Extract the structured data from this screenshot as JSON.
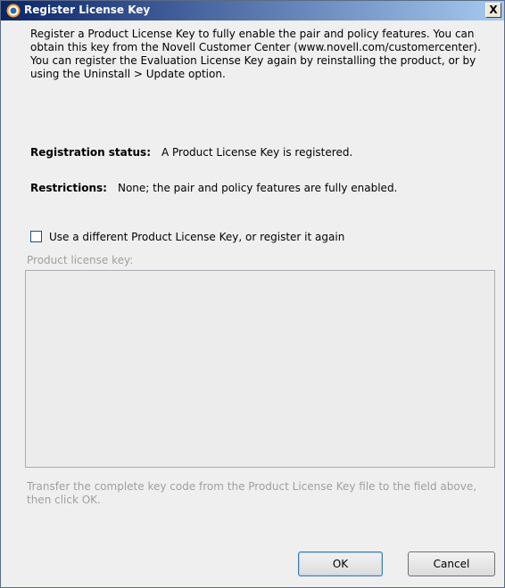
{
  "window": {
    "title": "Register License Key",
    "close_label": "X",
    "title_gradient": [
      "#0a246a",
      "#a6caf0"
    ]
  },
  "intro": {
    "text": "Register a Product License Key to fully enable the pair and policy features. You can obtain this key from the Novell Customer Center (www.novell.com/customercenter). You can register the Evaluation License Key again by reinstalling the product, or by using the Uninstall > Update option."
  },
  "registration": {
    "label": "Registration status:",
    "value": "A Product License Key is registered."
  },
  "restrictions": {
    "label": "Restrictions:",
    "value": "None; the pair and policy features are fully enabled."
  },
  "different_key": {
    "label": "Use a different Product License Key, or register it again",
    "checked": false
  },
  "license_field": {
    "label": "Product license key:",
    "value": "",
    "enabled": false
  },
  "hint": {
    "text": "Transfer the complete key code from the Product License Key file to the field above, then click OK."
  },
  "buttons": {
    "ok_label": "OK",
    "cancel_label": "Cancel"
  }
}
